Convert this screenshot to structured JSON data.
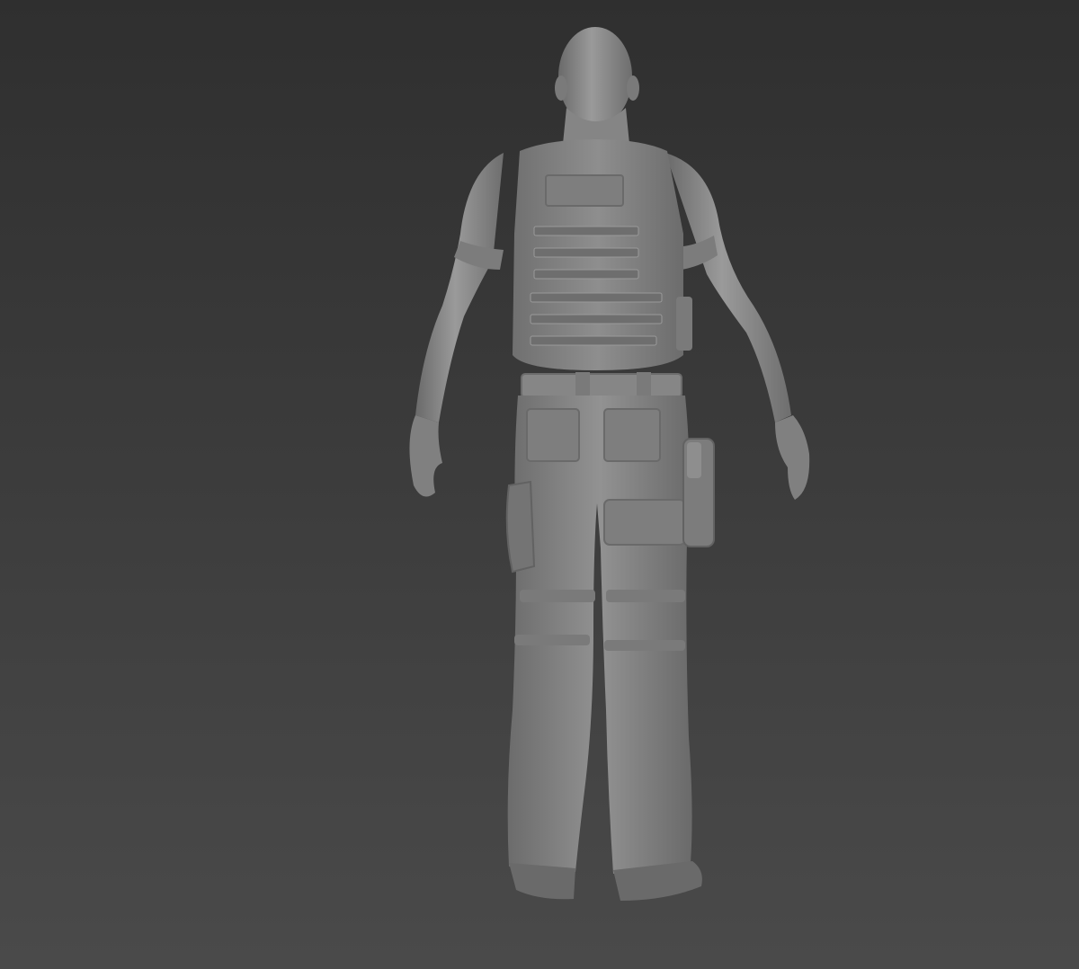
{
  "viewport": {
    "background_top": "#2f2f2f",
    "background_bottom": "#4a4a4a"
  },
  "model": {
    "material_color": "#8c8c8c",
    "shadow_color": "#5a5a5a",
    "highlight_color": "#b4b4b4"
  }
}
